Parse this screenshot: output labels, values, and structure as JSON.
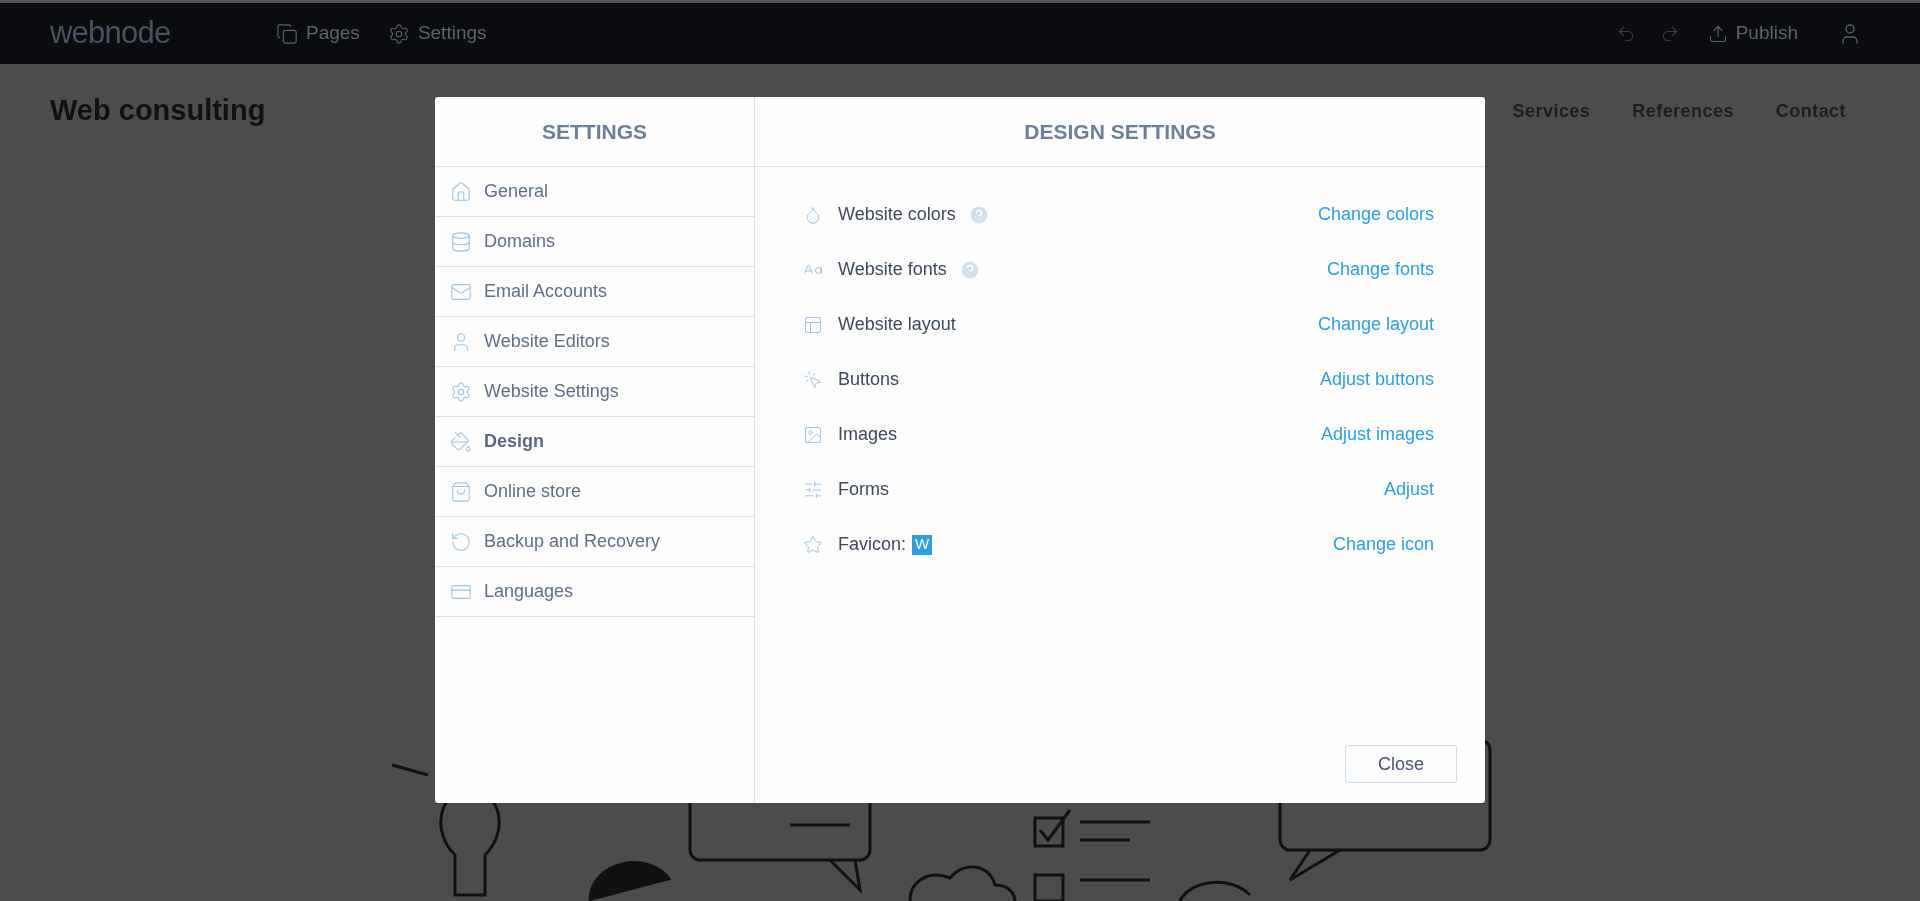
{
  "topbar": {
    "logo": "webnode",
    "nav": [
      {
        "label": "Pages",
        "kind": "pages"
      },
      {
        "label": "Settings",
        "kind": "settings"
      }
    ],
    "publish": "Publish"
  },
  "site": {
    "title": "Web consulting",
    "nav": [
      "Services",
      "References",
      "Contact"
    ]
  },
  "dialog": {
    "sidebar": {
      "title": "SETTINGS",
      "items": [
        {
          "label": "General",
          "selected": false
        },
        {
          "label": "Domains",
          "selected": false
        },
        {
          "label": "Email Accounts",
          "selected": false
        },
        {
          "label": "Website Editors",
          "selected": false
        },
        {
          "label": "Website Settings",
          "selected": false
        },
        {
          "label": "Design",
          "selected": true
        },
        {
          "label": "Online store",
          "selected": false
        },
        {
          "label": "Backup and Recovery",
          "selected": false
        },
        {
          "label": "Languages",
          "selected": false
        }
      ]
    },
    "panel": {
      "title": "DESIGN SETTINGS",
      "rows": [
        {
          "label": "Website colors",
          "help": true,
          "action": "Change colors"
        },
        {
          "label": "Website fonts",
          "help": true,
          "action": "Change fonts"
        },
        {
          "label": "Website layout",
          "help": false,
          "action": "Change layout"
        },
        {
          "label": "Buttons",
          "help": false,
          "action": "Adjust buttons"
        },
        {
          "label": "Images",
          "help": false,
          "action": "Adjust images"
        },
        {
          "label": "Forms",
          "help": false,
          "action": "Adjust"
        },
        {
          "label": "Favicon:",
          "help": false,
          "favicon": "W",
          "action": "Change icon"
        }
      ]
    },
    "close": "Close"
  }
}
